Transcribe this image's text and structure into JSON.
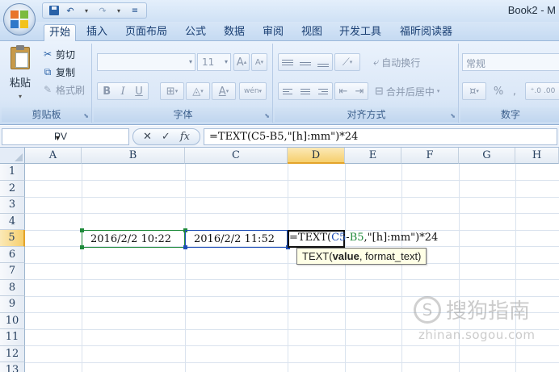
{
  "window": {
    "title": "Book2 - M"
  },
  "qat": {
    "save": "save-icon",
    "undo": "↶",
    "redo": "↷",
    "dropdown": "▾"
  },
  "tabs": [
    {
      "label": "开始",
      "active": true
    },
    {
      "label": "插入"
    },
    {
      "label": "页面布局"
    },
    {
      "label": "公式"
    },
    {
      "label": "数据"
    },
    {
      "label": "审阅"
    },
    {
      "label": "视图"
    },
    {
      "label": "开发工具"
    },
    {
      "label": "福昕阅读器"
    }
  ],
  "ribbon": {
    "clipboard": {
      "paste": "粘贴",
      "cut": "剪切",
      "copy": "复制",
      "format_painter": "格式刷",
      "group_label": "剪贴板"
    },
    "font": {
      "font_name": "",
      "font_size": "11",
      "grow": "A",
      "shrink": "A",
      "bold": "B",
      "italic": "I",
      "underline": "U",
      "font_color": "A",
      "phonetic": "wén",
      "group_label": "字体"
    },
    "alignment": {
      "wrap_text": "自动换行",
      "merge_center": "合并后居中",
      "group_label": "对齐方式"
    },
    "number": {
      "format": "常规",
      "percent": "%",
      "comma": ",",
      "group_label": "数字"
    }
  },
  "formula_bar": {
    "name_box": "PV",
    "cancel": "✕",
    "enter": "✓",
    "fx": "fx",
    "formula": "=TEXT(C5-B5,\"[h]:mm\")*24"
  },
  "grid": {
    "columns": [
      "A",
      "B",
      "C",
      "D",
      "E",
      "F",
      "G",
      "H"
    ],
    "rows": [
      "1",
      "2",
      "3",
      "4",
      "5",
      "6",
      "7",
      "8",
      "9",
      "10",
      "11",
      "12",
      "13"
    ],
    "selected_column": "D",
    "selected_row": "5",
    "cells": {
      "B5": "2016/2/2 10:22",
      "C5": "2016/2/2 11:52"
    },
    "editing": {
      "prefix": "=TEXT(",
      "ref1": "C5",
      "minus": "-",
      "ref2": "B5",
      "suffix": ",\"[h]:mm\")*24"
    },
    "tooltip": {
      "fn": "TEXT(",
      "arg1": "value",
      "rest": ", format_text)"
    }
  },
  "watermark": {
    "brand": "搜狗指南",
    "url": "zhinan.sogou.com"
  },
  "colors": {
    "ref_green": "#1e8a3a",
    "ref_blue": "#1f4fb8",
    "selected_header": "#f6cf6e"
  }
}
